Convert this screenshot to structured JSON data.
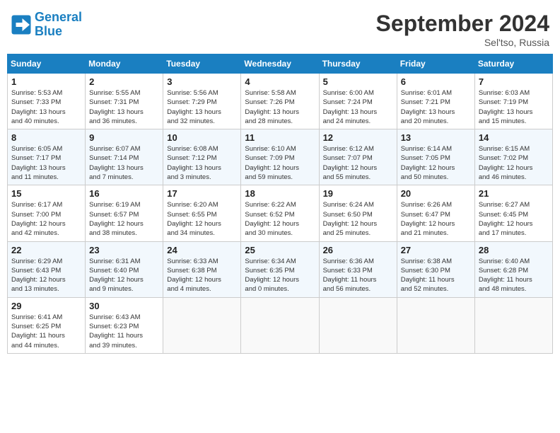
{
  "header": {
    "logo_line1": "General",
    "logo_line2": "Blue",
    "month": "September 2024",
    "location": "Sel'tso, Russia"
  },
  "weekdays": [
    "Sunday",
    "Monday",
    "Tuesday",
    "Wednesday",
    "Thursday",
    "Friday",
    "Saturday"
  ],
  "weeks": [
    [
      {
        "day": "1",
        "sunrise": "5:53 AM",
        "sunset": "7:33 PM",
        "daylight": "13 hours and 40 minutes."
      },
      {
        "day": "2",
        "sunrise": "5:55 AM",
        "sunset": "7:31 PM",
        "daylight": "13 hours and 36 minutes."
      },
      {
        "day": "3",
        "sunrise": "5:56 AM",
        "sunset": "7:29 PM",
        "daylight": "13 hours and 32 minutes."
      },
      {
        "day": "4",
        "sunrise": "5:58 AM",
        "sunset": "7:26 PM",
        "daylight": "13 hours and 28 minutes."
      },
      {
        "day": "5",
        "sunrise": "6:00 AM",
        "sunset": "7:24 PM",
        "daylight": "13 hours and 24 minutes."
      },
      {
        "day": "6",
        "sunrise": "6:01 AM",
        "sunset": "7:21 PM",
        "daylight": "13 hours and 20 minutes."
      },
      {
        "day": "7",
        "sunrise": "6:03 AM",
        "sunset": "7:19 PM",
        "daylight": "13 hours and 15 minutes."
      }
    ],
    [
      {
        "day": "8",
        "sunrise": "6:05 AM",
        "sunset": "7:17 PM",
        "daylight": "13 hours and 11 minutes."
      },
      {
        "day": "9",
        "sunrise": "6:07 AM",
        "sunset": "7:14 PM",
        "daylight": "13 hours and 7 minutes."
      },
      {
        "day": "10",
        "sunrise": "6:08 AM",
        "sunset": "7:12 PM",
        "daylight": "13 hours and 3 minutes."
      },
      {
        "day": "11",
        "sunrise": "6:10 AM",
        "sunset": "7:09 PM",
        "daylight": "12 hours and 59 minutes."
      },
      {
        "day": "12",
        "sunrise": "6:12 AM",
        "sunset": "7:07 PM",
        "daylight": "12 hours and 55 minutes."
      },
      {
        "day": "13",
        "sunrise": "6:14 AM",
        "sunset": "7:05 PM",
        "daylight": "12 hours and 50 minutes."
      },
      {
        "day": "14",
        "sunrise": "6:15 AM",
        "sunset": "7:02 PM",
        "daylight": "12 hours and 46 minutes."
      }
    ],
    [
      {
        "day": "15",
        "sunrise": "6:17 AM",
        "sunset": "7:00 PM",
        "daylight": "12 hours and 42 minutes."
      },
      {
        "day": "16",
        "sunrise": "6:19 AM",
        "sunset": "6:57 PM",
        "daylight": "12 hours and 38 minutes."
      },
      {
        "day": "17",
        "sunrise": "6:20 AM",
        "sunset": "6:55 PM",
        "daylight": "12 hours and 34 minutes."
      },
      {
        "day": "18",
        "sunrise": "6:22 AM",
        "sunset": "6:52 PM",
        "daylight": "12 hours and 30 minutes."
      },
      {
        "day": "19",
        "sunrise": "6:24 AM",
        "sunset": "6:50 PM",
        "daylight": "12 hours and 25 minutes."
      },
      {
        "day": "20",
        "sunrise": "6:26 AM",
        "sunset": "6:47 PM",
        "daylight": "12 hours and 21 minutes."
      },
      {
        "day": "21",
        "sunrise": "6:27 AM",
        "sunset": "6:45 PM",
        "daylight": "12 hours and 17 minutes."
      }
    ],
    [
      {
        "day": "22",
        "sunrise": "6:29 AM",
        "sunset": "6:43 PM",
        "daylight": "12 hours and 13 minutes."
      },
      {
        "day": "23",
        "sunrise": "6:31 AM",
        "sunset": "6:40 PM",
        "daylight": "12 hours and 9 minutes."
      },
      {
        "day": "24",
        "sunrise": "6:33 AM",
        "sunset": "6:38 PM",
        "daylight": "12 hours and 4 minutes."
      },
      {
        "day": "25",
        "sunrise": "6:34 AM",
        "sunset": "6:35 PM",
        "daylight": "12 hours and 0 minutes."
      },
      {
        "day": "26",
        "sunrise": "6:36 AM",
        "sunset": "6:33 PM",
        "daylight": "11 hours and 56 minutes."
      },
      {
        "day": "27",
        "sunrise": "6:38 AM",
        "sunset": "6:30 PM",
        "daylight": "11 hours and 52 minutes."
      },
      {
        "day": "28",
        "sunrise": "6:40 AM",
        "sunset": "6:28 PM",
        "daylight": "11 hours and 48 minutes."
      }
    ],
    [
      {
        "day": "29",
        "sunrise": "6:41 AM",
        "sunset": "6:25 PM",
        "daylight": "11 hours and 44 minutes."
      },
      {
        "day": "30",
        "sunrise": "6:43 AM",
        "sunset": "6:23 PM",
        "daylight": "11 hours and 39 minutes."
      },
      null,
      null,
      null,
      null,
      null
    ]
  ]
}
